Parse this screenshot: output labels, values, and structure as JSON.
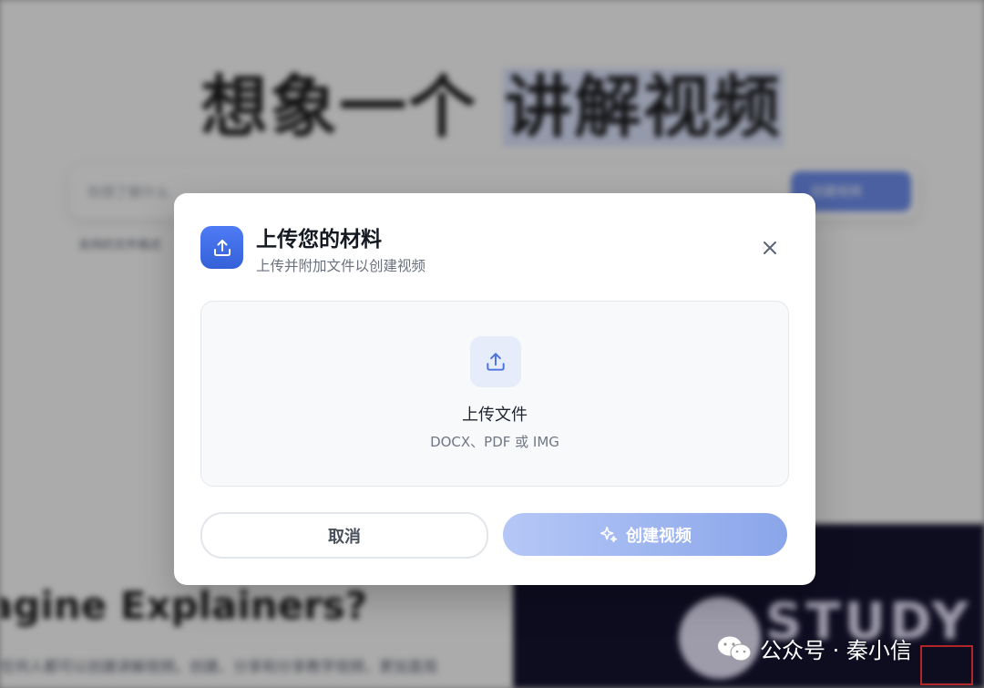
{
  "background": {
    "hero_title_part1": "想象一个",
    "hero_title_highlight": "讲解视频",
    "prompt_placeholder": "你想了解什么",
    "prompt_button_label": "创建视频",
    "hint_text": "支持的文件格式",
    "section_title": "agine Explainers?",
    "section_body": "任何人都可以创建讲解视频。创建、分享和分享教学视频，更加直观",
    "banner_text": "STUDY FEST"
  },
  "modal": {
    "title": "上传您的材料",
    "subtitle": "上传并附加文件以创建视频",
    "header_icon": "upload-icon",
    "close_icon": "close-icon",
    "dropzone": {
      "icon": "upload-icon",
      "title": "上传文件",
      "hint": "DOCX、PDF 或 IMG"
    },
    "cancel_label": "取消",
    "create_label": "创建视频",
    "create_icon": "sparkle-icon"
  },
  "watermark": {
    "icon": "wechat-icon",
    "text": "公众号 · 秦小信"
  },
  "colors": {
    "accent": "#3f6fe6",
    "create_button_start": "#b5c7f6",
    "create_button_end": "#8aa6ea",
    "dropzone_bg": "#f8f9fb"
  }
}
